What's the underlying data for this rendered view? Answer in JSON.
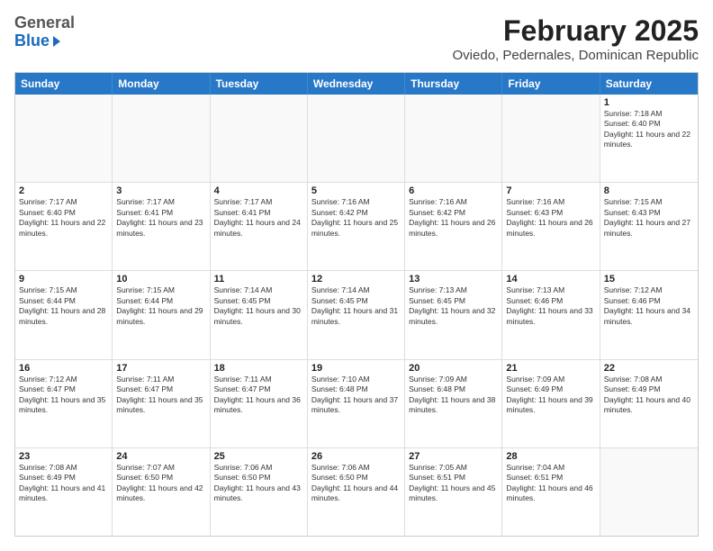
{
  "logo": {
    "general": "General",
    "blue": "Blue"
  },
  "title": "February 2025",
  "subtitle": "Oviedo, Pedernales, Dominican Republic",
  "header_days": [
    "Sunday",
    "Monday",
    "Tuesday",
    "Wednesday",
    "Thursday",
    "Friday",
    "Saturday"
  ],
  "weeks": [
    [
      {
        "day": "",
        "text": ""
      },
      {
        "day": "",
        "text": ""
      },
      {
        "day": "",
        "text": ""
      },
      {
        "day": "",
        "text": ""
      },
      {
        "day": "",
        "text": ""
      },
      {
        "day": "",
        "text": ""
      },
      {
        "day": "1",
        "text": "Sunrise: 7:18 AM\nSunset: 6:40 PM\nDaylight: 11 hours and 22 minutes."
      }
    ],
    [
      {
        "day": "2",
        "text": "Sunrise: 7:17 AM\nSunset: 6:40 PM\nDaylight: 11 hours and 22 minutes."
      },
      {
        "day": "3",
        "text": "Sunrise: 7:17 AM\nSunset: 6:41 PM\nDaylight: 11 hours and 23 minutes."
      },
      {
        "day": "4",
        "text": "Sunrise: 7:17 AM\nSunset: 6:41 PM\nDaylight: 11 hours and 24 minutes."
      },
      {
        "day": "5",
        "text": "Sunrise: 7:16 AM\nSunset: 6:42 PM\nDaylight: 11 hours and 25 minutes."
      },
      {
        "day": "6",
        "text": "Sunrise: 7:16 AM\nSunset: 6:42 PM\nDaylight: 11 hours and 26 minutes."
      },
      {
        "day": "7",
        "text": "Sunrise: 7:16 AM\nSunset: 6:43 PM\nDaylight: 11 hours and 26 minutes."
      },
      {
        "day": "8",
        "text": "Sunrise: 7:15 AM\nSunset: 6:43 PM\nDaylight: 11 hours and 27 minutes."
      }
    ],
    [
      {
        "day": "9",
        "text": "Sunrise: 7:15 AM\nSunset: 6:44 PM\nDaylight: 11 hours and 28 minutes."
      },
      {
        "day": "10",
        "text": "Sunrise: 7:15 AM\nSunset: 6:44 PM\nDaylight: 11 hours and 29 minutes."
      },
      {
        "day": "11",
        "text": "Sunrise: 7:14 AM\nSunset: 6:45 PM\nDaylight: 11 hours and 30 minutes."
      },
      {
        "day": "12",
        "text": "Sunrise: 7:14 AM\nSunset: 6:45 PM\nDaylight: 11 hours and 31 minutes."
      },
      {
        "day": "13",
        "text": "Sunrise: 7:13 AM\nSunset: 6:45 PM\nDaylight: 11 hours and 32 minutes."
      },
      {
        "day": "14",
        "text": "Sunrise: 7:13 AM\nSunset: 6:46 PM\nDaylight: 11 hours and 33 minutes."
      },
      {
        "day": "15",
        "text": "Sunrise: 7:12 AM\nSunset: 6:46 PM\nDaylight: 11 hours and 34 minutes."
      }
    ],
    [
      {
        "day": "16",
        "text": "Sunrise: 7:12 AM\nSunset: 6:47 PM\nDaylight: 11 hours and 35 minutes."
      },
      {
        "day": "17",
        "text": "Sunrise: 7:11 AM\nSunset: 6:47 PM\nDaylight: 11 hours and 35 minutes."
      },
      {
        "day": "18",
        "text": "Sunrise: 7:11 AM\nSunset: 6:47 PM\nDaylight: 11 hours and 36 minutes."
      },
      {
        "day": "19",
        "text": "Sunrise: 7:10 AM\nSunset: 6:48 PM\nDaylight: 11 hours and 37 minutes."
      },
      {
        "day": "20",
        "text": "Sunrise: 7:09 AM\nSunset: 6:48 PM\nDaylight: 11 hours and 38 minutes."
      },
      {
        "day": "21",
        "text": "Sunrise: 7:09 AM\nSunset: 6:49 PM\nDaylight: 11 hours and 39 minutes."
      },
      {
        "day": "22",
        "text": "Sunrise: 7:08 AM\nSunset: 6:49 PM\nDaylight: 11 hours and 40 minutes."
      }
    ],
    [
      {
        "day": "23",
        "text": "Sunrise: 7:08 AM\nSunset: 6:49 PM\nDaylight: 11 hours and 41 minutes."
      },
      {
        "day": "24",
        "text": "Sunrise: 7:07 AM\nSunset: 6:50 PM\nDaylight: 11 hours and 42 minutes."
      },
      {
        "day": "25",
        "text": "Sunrise: 7:06 AM\nSunset: 6:50 PM\nDaylight: 11 hours and 43 minutes."
      },
      {
        "day": "26",
        "text": "Sunrise: 7:06 AM\nSunset: 6:50 PM\nDaylight: 11 hours and 44 minutes."
      },
      {
        "day": "27",
        "text": "Sunrise: 7:05 AM\nSunset: 6:51 PM\nDaylight: 11 hours and 45 minutes."
      },
      {
        "day": "28",
        "text": "Sunrise: 7:04 AM\nSunset: 6:51 PM\nDaylight: 11 hours and 46 minutes."
      },
      {
        "day": "",
        "text": ""
      }
    ]
  ]
}
